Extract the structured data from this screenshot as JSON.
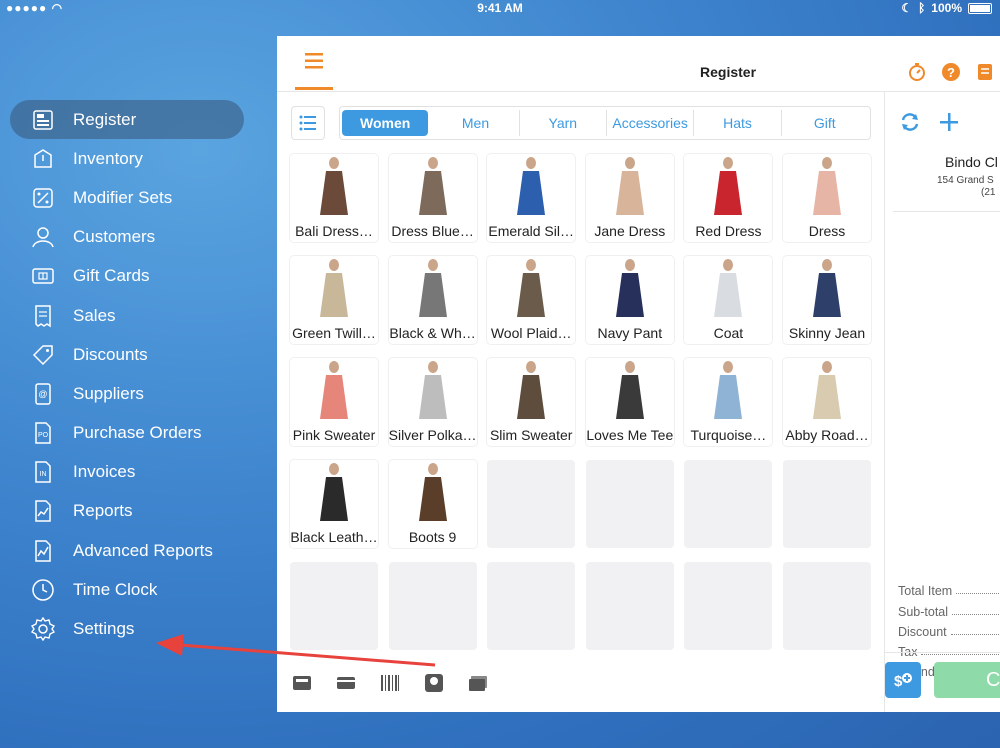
{
  "status_bar": {
    "signal": "●●●●●",
    "time": "9:41 AM",
    "battery": "100%"
  },
  "sidebar": {
    "items": [
      {
        "label": "Register",
        "icon": "register-icon",
        "active": true
      },
      {
        "label": "Inventory",
        "icon": "inventory-icon"
      },
      {
        "label": "Modifier Sets",
        "icon": "modifier-sets-icon"
      },
      {
        "label": "Customers",
        "icon": "customers-icon"
      },
      {
        "label": "Gift Cards",
        "icon": "gift-card-icon"
      },
      {
        "label": "Sales",
        "icon": "sales-receipt-icon"
      },
      {
        "label": "Discounts",
        "icon": "tag-icon"
      },
      {
        "label": "Suppliers",
        "icon": "suppliers-icon"
      },
      {
        "label": "Purchase Orders",
        "icon": "purchase-order-icon",
        "badge": "PO"
      },
      {
        "label": "Invoices",
        "icon": "invoice-icon",
        "badge": "IN"
      },
      {
        "label": "Reports",
        "icon": "reports-icon"
      },
      {
        "label": "Advanced Reports",
        "icon": "advanced-reports-icon"
      },
      {
        "label": "Time Clock",
        "icon": "clock-icon"
      },
      {
        "label": "Settings",
        "icon": "gear-icon"
      }
    ]
  },
  "header": {
    "title": "Register"
  },
  "categories": [
    {
      "label": "Women",
      "active": true
    },
    {
      "label": "Men"
    },
    {
      "label": "Yarn"
    },
    {
      "label": "Accessories"
    },
    {
      "label": "Hats"
    },
    {
      "label": "Gift"
    }
  ],
  "products": [
    {
      "name": "Bali Dress…",
      "color": "#6b4a3a"
    },
    {
      "name": "Dress Blue…",
      "color": "#7d6a5a"
    },
    {
      "name": "Emerald Sil…",
      "color": "#2c5fae"
    },
    {
      "name": "Jane Dress",
      "color": "#d8b59a"
    },
    {
      "name": "Red Dress",
      "color": "#c8252e"
    },
    {
      "name": "Dress",
      "color": "#e7b5a6"
    },
    {
      "name": "Green Twill…",
      "color": "#c9b79a"
    },
    {
      "name": "Black & Wh…",
      "color": "#777"
    },
    {
      "name": "Wool Plaid…",
      "color": "#6a5b4a"
    },
    {
      "name": "Navy Pant",
      "color": "#26305a"
    },
    {
      "name": "Coat",
      "color": "#d9dde2"
    },
    {
      "name": "Skinny Jean",
      "color": "#2e3f6a"
    },
    {
      "name": "Pink Sweater",
      "color": "#e6857a"
    },
    {
      "name": "Silver Polka…",
      "color": "#bdbdbd"
    },
    {
      "name": "Slim Sweater",
      "color": "#5e4c3c"
    },
    {
      "name": "Loves Me Tee",
      "color": "#3a3a3a"
    },
    {
      "name": "Turquoise…",
      "color": "#8fb3d4"
    },
    {
      "name": "Abby Road…",
      "color": "#d8cbb0"
    },
    {
      "name": "Black Leath…",
      "color": "#2a2a2a"
    },
    {
      "name": "Boots 9",
      "color": "#5a3e2a"
    }
  ],
  "cart": {
    "store_name": "Bindo Cl",
    "store_address": "154 Grand S",
    "store_phone": "(21",
    "totals": [
      {
        "label": "Total Item"
      },
      {
        "label": "Sub-total"
      },
      {
        "label": "Discount"
      },
      {
        "label": "Tax"
      },
      {
        "label": "Rounding"
      }
    ],
    "charge_label": "C"
  }
}
